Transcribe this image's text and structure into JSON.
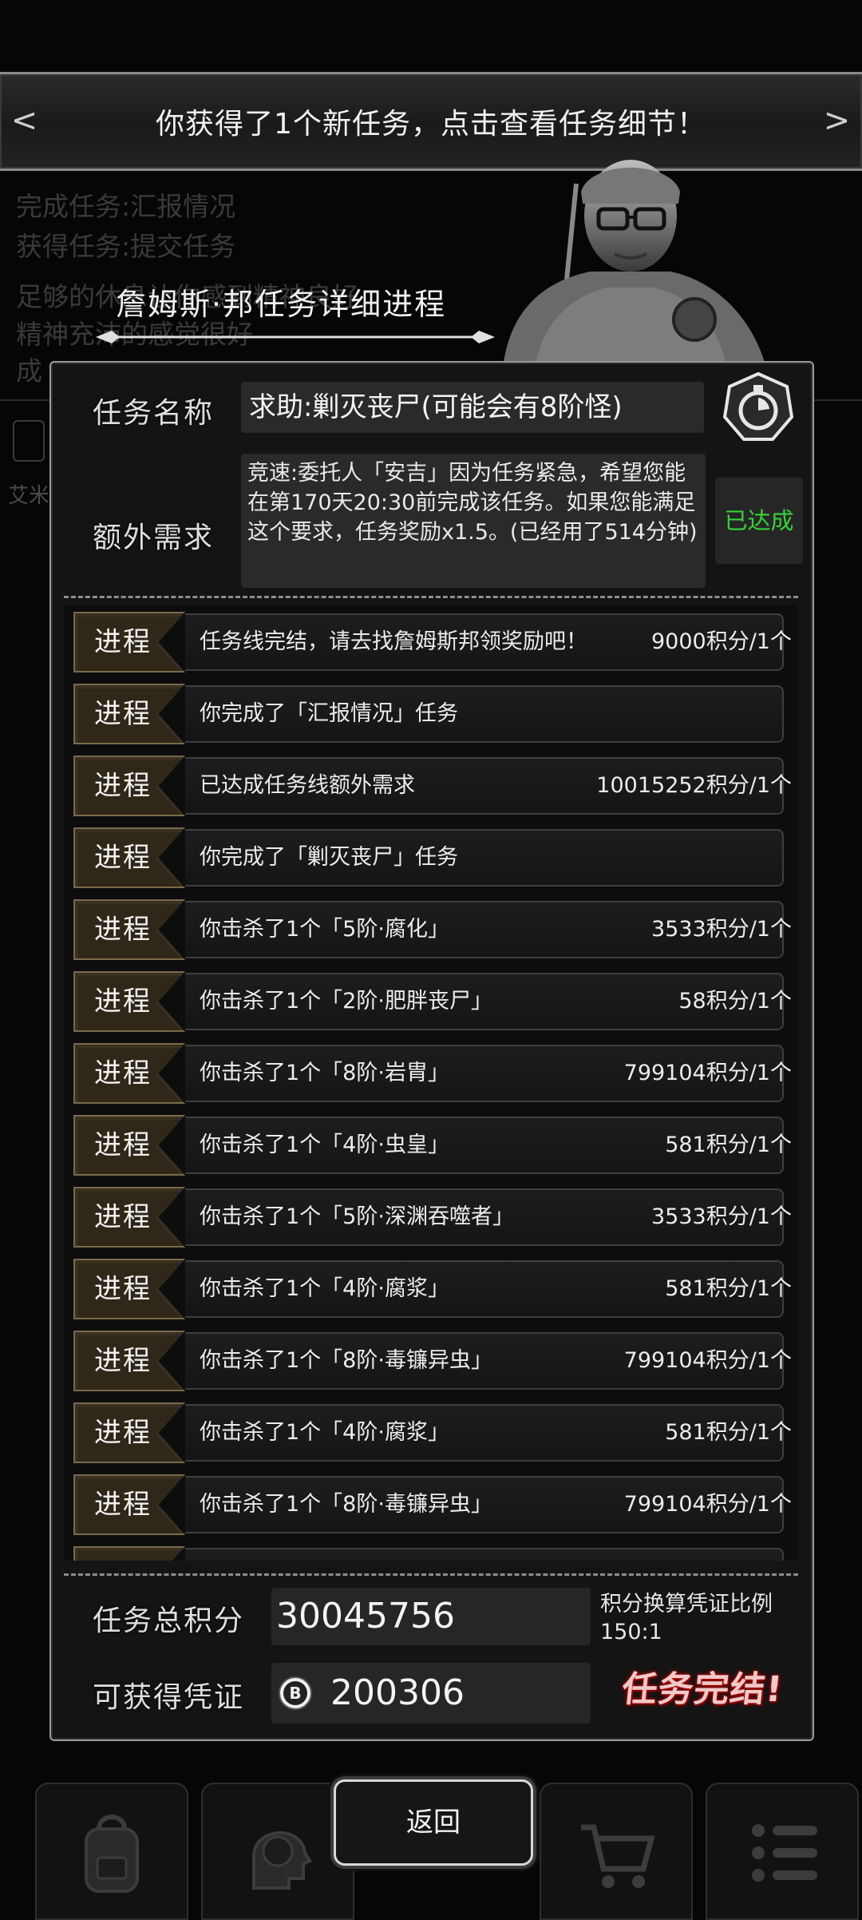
{
  "notice": {
    "text": "你获得了1个新任务，点击查看任务细节！",
    "left_arrow": "<",
    "right_arrow": ">"
  },
  "background_log": [
    "完成任务:汇报情况",
    "获得任务:提交任务",
    "足够的休息让你感到精神良好",
    "精神充沛的感觉很好",
    "成"
  ],
  "background_side": "艾米",
  "panel": {
    "title": "詹姆斯·邦任务详细进程",
    "mission_name_label": "任务名称",
    "mission_name": "求助:剿灭丧尸(可能会有8阶怪)",
    "extra_req_label": "额外需求",
    "extra_req_text": "竞速:委托人「安吉」因为任务紧急，希望您能在第170天20:30前完成该任务。如果您能满足这个要求，任务奖励x1.5。(已经用了514分钟)",
    "achieved": "已达成"
  },
  "progress": {
    "tag": "进程",
    "rows": [
      {
        "text": "任务线完结，请去找詹姆斯邦领奖励吧！",
        "reward": "9000积分/1个"
      },
      {
        "text": "你完成了「汇报情况」任务",
        "reward": ""
      },
      {
        "text": "已达成任务线额外需求",
        "reward": "10015252积分/1个"
      },
      {
        "text": "你完成了「剿灭丧尸」任务",
        "reward": ""
      },
      {
        "text": "你击杀了1个「5阶·腐化」",
        "reward": "3533积分/1个"
      },
      {
        "text": "你击杀了1个「2阶·肥胖丧尸」",
        "reward": "58积分/1个"
      },
      {
        "text": "你击杀了1个「8阶·岩胄」",
        "reward": "799104积分/1个"
      },
      {
        "text": "你击杀了1个「4阶·虫皇」",
        "reward": "581积分/1个"
      },
      {
        "text": "你击杀了1个「5阶·深渊吞噬者」",
        "reward": "3533积分/1个"
      },
      {
        "text": "你击杀了1个「4阶·腐浆」",
        "reward": "581积分/1个"
      },
      {
        "text": "你击杀了1个「8阶·毒镰异虫」",
        "reward": "799104积分/1个"
      },
      {
        "text": "你击杀了1个「4阶·腐浆」",
        "reward": "581积分/1个"
      },
      {
        "text": "你击杀了1个「8阶·毒镰异虫」",
        "reward": "799104积分/1个"
      }
    ]
  },
  "totals": {
    "total_label": "任务总积分",
    "total_value": "30045756",
    "ratio_label": "积分换算凭证比例",
    "ratio_value": "150:1",
    "voucher_label": "可获得凭证",
    "voucher_value": "200306",
    "complete_button": "任务完结!"
  },
  "nav": {
    "back_button": "返回",
    "icons": [
      "backpack-icon",
      "brain-icon",
      "cart-icon",
      "menu-icon"
    ]
  },
  "colors": {
    "achieved": "#39d039",
    "tag_border": "#7a6a4a",
    "complete_glow": "#b11"
  }
}
